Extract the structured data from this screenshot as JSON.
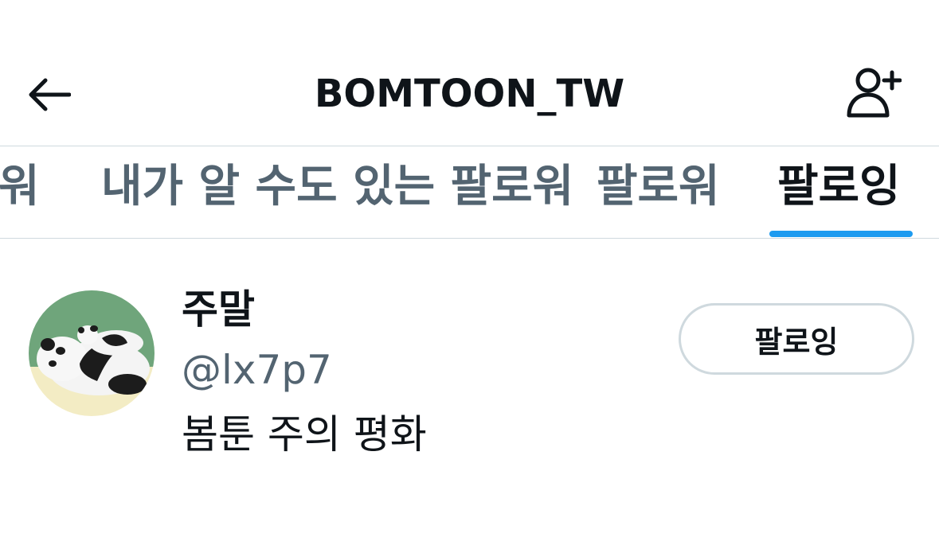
{
  "header": {
    "title": "BOMTOON_TW",
    "back_icon": "arrow-left-icon",
    "add_user_icon": "add-user-icon"
  },
  "tabs": [
    {
      "label": "워"
    },
    {
      "label": "내가 알 수도 있는 팔로워"
    },
    {
      "label": "팔로워"
    },
    {
      "label": "팔로잉",
      "active": true
    }
  ],
  "user": {
    "display_name": "주말",
    "handle": "@lx7p7",
    "bio": "봄툰 주의 평화",
    "follow_button_label": "팔로잉"
  },
  "colors": {
    "accent": "#1d9bf0",
    "text_primary": "#0f1419",
    "text_secondary": "#536471",
    "border": "#cfd9de"
  }
}
